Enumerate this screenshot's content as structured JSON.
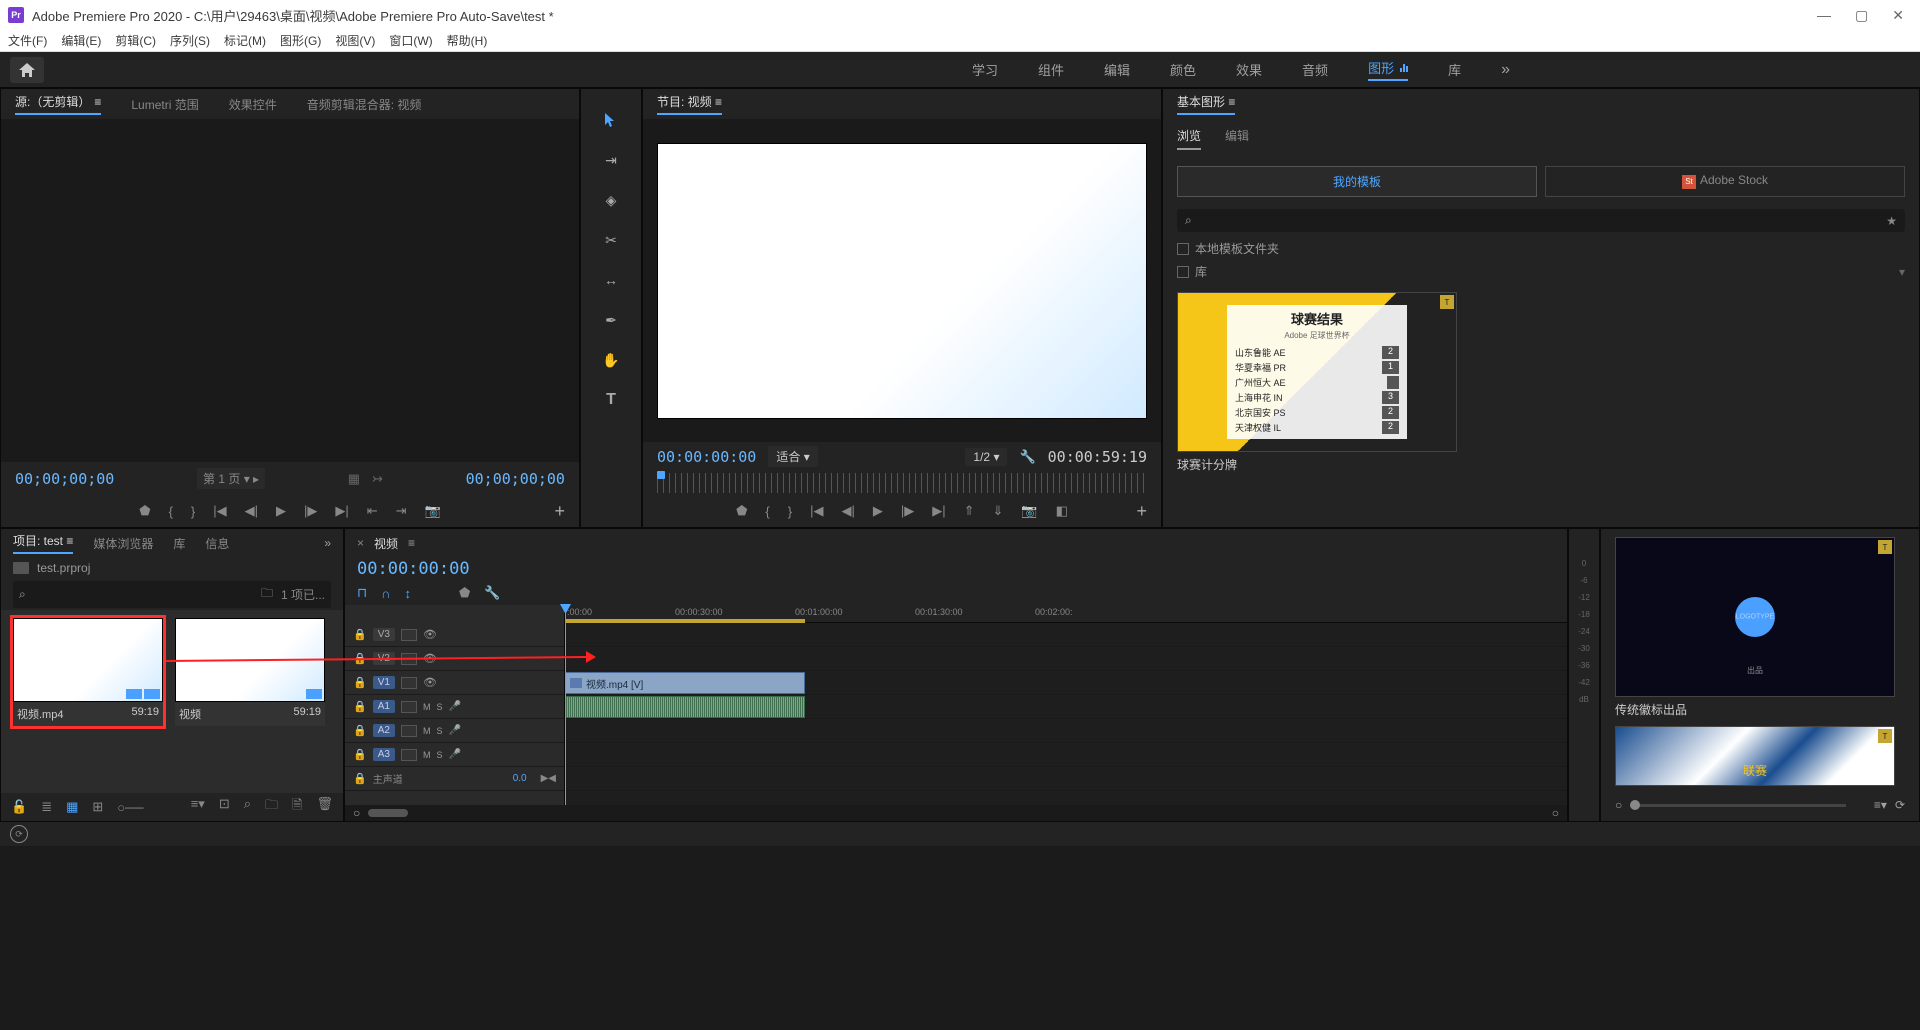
{
  "title": "Adobe Premiere Pro 2020 - C:\\用户\\29463\\桌面\\视频\\Adobe Premiere Pro Auto-Save\\test *",
  "menubar": [
    "文件(F)",
    "编辑(E)",
    "剪辑(C)",
    "序列(S)",
    "标记(M)",
    "图形(G)",
    "视图(V)",
    "窗口(W)",
    "帮助(H)"
  ],
  "workspaces": [
    "学习",
    "组件",
    "编辑",
    "颜色",
    "效果",
    "音频",
    "图形",
    "库"
  ],
  "workspace_active": "图形",
  "source": {
    "tabs": [
      "源:（无剪辑）",
      "Lumetri 范围",
      "效果控件",
      "音频剪辑混合器: 视频"
    ],
    "tc_in": "00;00;00;00",
    "tc_out": "00;00;00;00",
    "page": "第 1 页"
  },
  "program": {
    "title": "节目: 视频",
    "tc_in": "00:00:00:00",
    "fit": "适合",
    "zoom": "1/2",
    "tc_out": "00:00:59:19"
  },
  "eg": {
    "title": "基本图形",
    "tabs": [
      "浏览",
      "编辑"
    ],
    "my_templates": "我的模板",
    "adobe_stock": "Adobe Stock",
    "check_local": "本地模板文件夹",
    "check_lib": "库",
    "templates": [
      {
        "name": "球赛计分牌",
        "sb_title": "球赛结果",
        "sb_sub": "Adobe 足球世界杯",
        "rows": [
          [
            "山东鲁能 AE",
            "2"
          ],
          [
            "华夏幸福 PR",
            "1"
          ],
          [
            "广州恒大 AE",
            ""
          ],
          [
            "上海申花 IN",
            "3"
          ],
          [
            "北京国安 PS",
            "2"
          ],
          [
            "天津权健 IL",
            "2"
          ]
        ]
      },
      {
        "name": "传统徽标出品",
        "logo_sub": "出品"
      },
      {
        "name": "联赛"
      }
    ]
  },
  "project": {
    "tabs": [
      "项目: test",
      "媒体浏览器",
      "库",
      "信息"
    ],
    "file": "test.prproj",
    "count": "1 项已...",
    "clips": [
      {
        "name": "视频.mp4",
        "dur": "59:19",
        "selected": true
      },
      {
        "name": "视频",
        "dur": "59:19",
        "selected": false
      }
    ]
  },
  "timeline": {
    "name": "视频",
    "tc": "00:00:00:00",
    "ruler": [
      ":00:00",
      "00:00:30:00",
      "00:01:00:00",
      "00:01:30:00",
      "00:02:00:"
    ],
    "tracks_v": [
      "V3",
      "V2",
      "V1"
    ],
    "tracks_a": [
      "A1",
      "A2",
      "A3"
    ],
    "clip_label": "视频.mp4 [V]",
    "master": "主声道",
    "master_val": "0.0"
  },
  "meter_labels": [
    "0",
    "-6",
    "-12",
    "-18",
    "-24",
    "-30",
    "-36",
    "-42",
    "dB"
  ]
}
